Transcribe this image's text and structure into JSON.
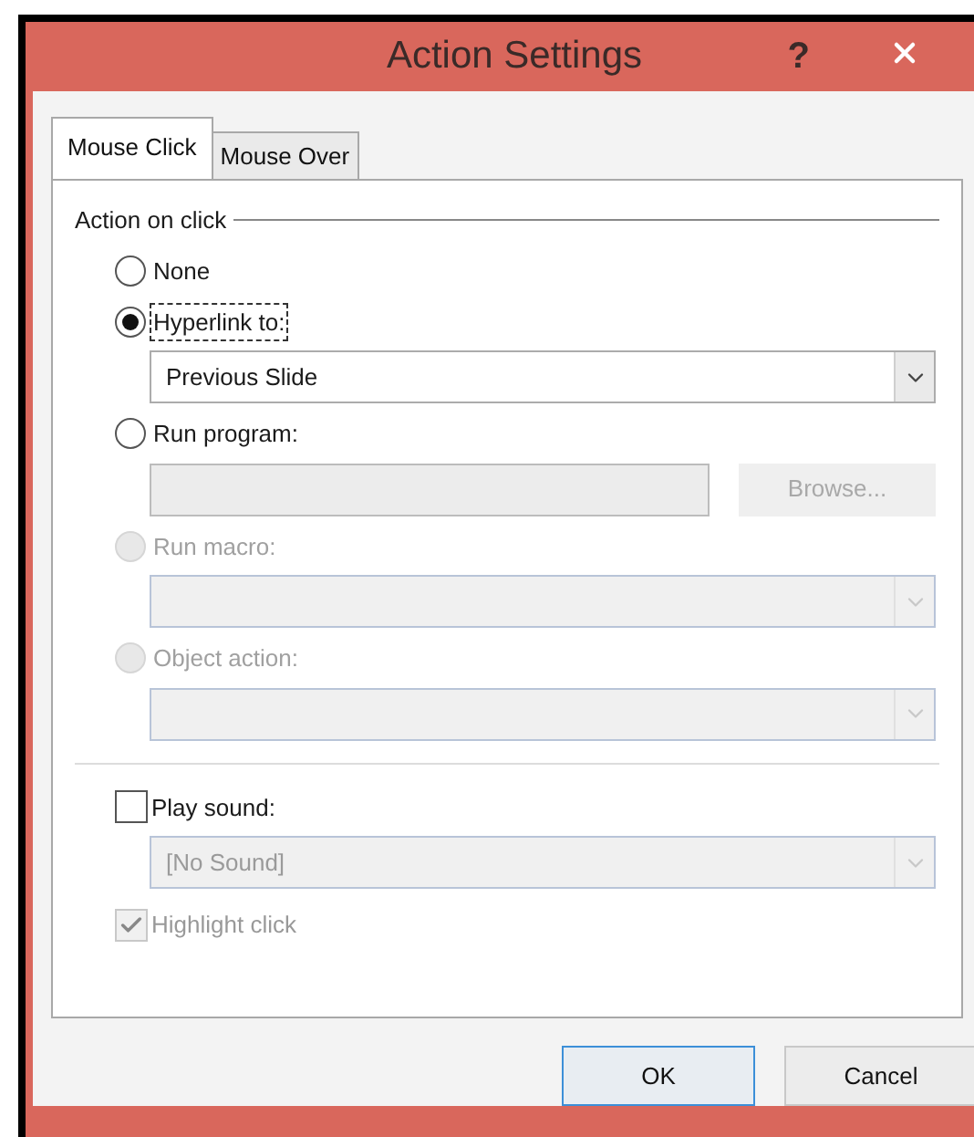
{
  "window": {
    "title": "Action Settings",
    "help": "?"
  },
  "tabs": [
    {
      "label": "Mouse Click",
      "selected": true
    },
    {
      "label": "Mouse Over",
      "selected": false
    }
  ],
  "group": {
    "title": "Action on click",
    "options": [
      {
        "kind": "radio",
        "label": "None",
        "selected": false,
        "disabled": false,
        "focused": false
      },
      {
        "kind": "radio",
        "label": "Hyperlink to:",
        "selected": true,
        "disabled": false,
        "focused": true,
        "dropdown": {
          "value": "Previous Slide",
          "disabled": false
        }
      },
      {
        "kind": "radio",
        "label": "Run program:",
        "selected": false,
        "disabled": false,
        "focused": false,
        "field": {
          "disabled": true
        },
        "button": {
          "label": "Browse...",
          "disabled": true
        }
      },
      {
        "kind": "radio",
        "label": "Run macro:",
        "selected": false,
        "disabled": true,
        "focused": false,
        "dropdown": {
          "disabled": true
        }
      },
      {
        "kind": "radio",
        "label": "Object action:",
        "selected": false,
        "disabled": true,
        "focused": false,
        "dropdown": {
          "disabled": true
        }
      }
    ]
  },
  "sound": {
    "label": "Play sound:",
    "checked": false,
    "disabled": false,
    "dropdown": {
      "value": "[No Sound]",
      "disabled": true
    }
  },
  "highlight": {
    "label": "Highlight click",
    "checked": true,
    "disabled": true
  },
  "buttons": [
    {
      "label": "OK",
      "default": true
    },
    {
      "label": "Cancel",
      "default": false
    }
  ]
}
